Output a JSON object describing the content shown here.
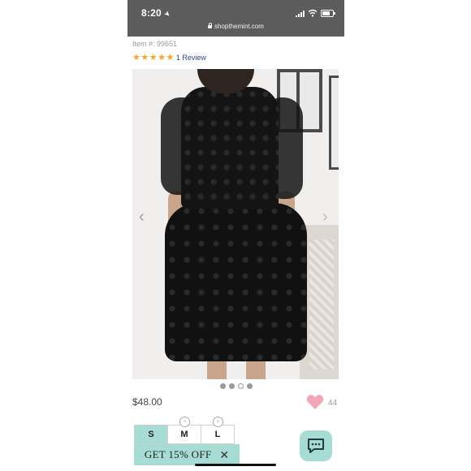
{
  "status_bar": {
    "time": "8:20",
    "url": "shopthemint.com"
  },
  "product": {
    "item_number": "Item #: 99651",
    "rating_stars": 5,
    "reviews_link": "1 Review",
    "price": "$48.00",
    "likes": "44",
    "image_count": 4,
    "active_image_index": 2
  },
  "sizes": [
    "S",
    "M",
    "L"
  ],
  "promo": {
    "text": "GET 15% OFF"
  },
  "colors": {
    "accent": "#a7dcd4",
    "star": "#f5a623",
    "heart": "#f2a7b8"
  },
  "icons": [
    "location-arrow-icon",
    "signal-icon",
    "wifi-icon",
    "battery-icon",
    "lock-icon",
    "star-icon",
    "heart-icon",
    "hanger-icon",
    "close-icon",
    "chat-icon",
    "chevron-left-icon",
    "chevron-right-icon"
  ]
}
